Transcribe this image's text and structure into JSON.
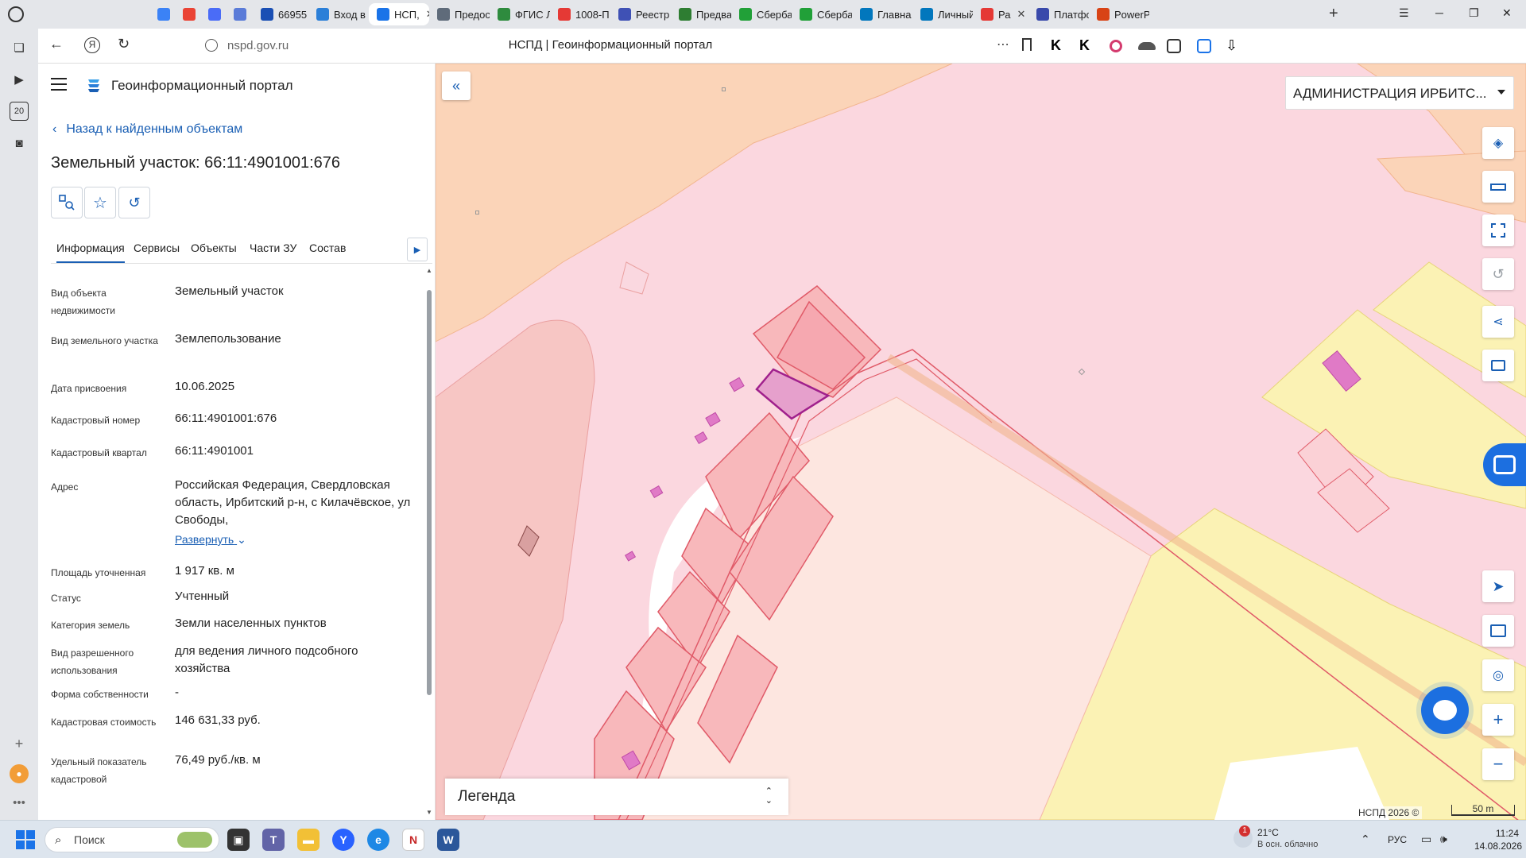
{
  "browser": {
    "tabs": [
      {
        "label": "",
        "color": "#e4e6ea",
        "active": false
      },
      {
        "label": "",
        "color": "#e4e6ea",
        "active": false
      },
      {
        "label": "",
        "color": "#3b82f6",
        "active": false
      },
      {
        "label": "",
        "color": "#ea4335",
        "active": false
      },
      {
        "label": "",
        "color": "#4a6cf7",
        "active": false
      },
      {
        "label": "",
        "color": "#5a7bd8",
        "active": false
      },
      {
        "label": "66955",
        "color": "#1a4fb4",
        "active": false
      },
      {
        "label": "Вход в с",
        "color": "#2b7fd8",
        "active": false
      },
      {
        "label": "НСП,",
        "color": "#1a73e8",
        "active": true
      },
      {
        "label": "Предос",
        "color": "#5f6b7a",
        "active": false
      },
      {
        "label": "ФГИС Л",
        "color": "#2e8b3e",
        "active": false
      },
      {
        "label": "1008-П",
        "color": "#e53935",
        "active": false
      },
      {
        "label": "Реестр",
        "color": "#3f51b5",
        "active": false
      },
      {
        "label": "Предва",
        "color": "#2e7d32",
        "active": false
      },
      {
        "label": "Сберба",
        "color": "#21a038",
        "active": false
      },
      {
        "label": "Сберба",
        "color": "#21a038",
        "active": false
      },
      {
        "label": "Главна",
        "color": "#0277bd",
        "active": false
      },
      {
        "label": "Личный",
        "color": "#0277bd",
        "active": false
      },
      {
        "label": "Ра",
        "color": "#e53935",
        "active": false
      },
      {
        "label": "Платфо",
        "color": "#3949ab",
        "active": false
      },
      {
        "label": "PowerP",
        "color": "#d84315",
        "active": false
      }
    ],
    "url": "nspd.gov.ru",
    "page_title": "НСПД | Геоинформационный портал",
    "sidebar_counter": "20"
  },
  "panel": {
    "portal_title": "Геоинформационный портал",
    "back_link": "Назад к найденным объектам",
    "object_title": "Земельный участок: 66:11:4901001:676",
    "tabs": [
      "Информация",
      "Сервисы",
      "Объекты",
      "Части ЗУ",
      "Состав"
    ],
    "expand_label": "Развернуть",
    "rows": [
      {
        "label": "Вид объекта недвижимости",
        "value": "Земельный участок"
      },
      {
        "label": "Вид земельного участка",
        "value": "Землепользование"
      },
      {
        "label": "Дата присвоения",
        "value": "10.06.2025"
      },
      {
        "label": "Кадастровый номер",
        "value": "66:11:4901001:676"
      },
      {
        "label": "Кадастровый квартал",
        "value": "66:11:4901001"
      },
      {
        "label": "Адрес",
        "value": "Российская Федерация, Свердловская область, Ирбитский р-н, с Килачёвское, ул Свободы,"
      },
      {
        "label": "Площадь уточненная",
        "value": "1 917 кв. м"
      },
      {
        "label": "Статус",
        "value": "Учтенный"
      },
      {
        "label": "Категория земель",
        "value": "Земли населенных пунктов"
      },
      {
        "label": "Вид разрешенного использования",
        "value": "для ведения личного подсобного хозяйства"
      },
      {
        "label": "Форма собственности",
        "value": "-"
      },
      {
        "label": "Кадастровая стоимость",
        "value": "146 631,33 руб."
      },
      {
        "label": "Удельный показатель кадастровой",
        "value": "76,49 руб./кв. м"
      }
    ]
  },
  "map": {
    "org_select": "АДМИНИСТРАЦИЯ ИРБИТС...",
    "legend": "Легенда",
    "copyright": "НСПД 2026 ©",
    "scale": "50 m"
  },
  "taskbar": {
    "search_placeholder": "Поиск",
    "weather_temp": "21°C",
    "weather_desc": "В осн. облачно",
    "weather_badge": "1",
    "lang": "РУС",
    "time": "11:24",
    "date": "14.08.2026"
  }
}
